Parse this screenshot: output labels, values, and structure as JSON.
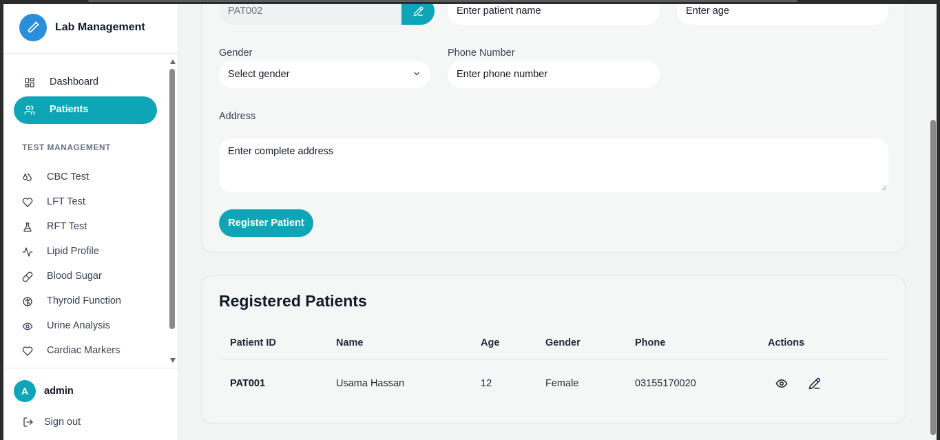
{
  "app": {
    "title": "Lab Management"
  },
  "colors": {
    "accent": "#0ea5b7",
    "logo": "#2a8fd8"
  },
  "sidebar": {
    "nav": [
      {
        "label": "Dashboard",
        "icon": "dashboard-icon"
      },
      {
        "label": "Patients",
        "icon": "users-icon",
        "active": true
      }
    ],
    "section_label": "TEST MANAGEMENT",
    "tests": [
      {
        "label": "CBC Test",
        "icon": "droplets-icon"
      },
      {
        "label": "LFT Test",
        "icon": "heart-icon"
      },
      {
        "label": "RFT Test",
        "icon": "flask-icon"
      },
      {
        "label": "Lipid Profile",
        "icon": "activity-icon"
      },
      {
        "label": "Blood Sugar",
        "icon": "pill-icon"
      },
      {
        "label": "Thyroid Function",
        "icon": "brain-icon"
      },
      {
        "label": "Urine Analysis",
        "icon": "eye-icon"
      },
      {
        "label": "Cardiac Markers",
        "icon": "heart-icon"
      }
    ],
    "user": {
      "initial": "A",
      "name": "admin"
    },
    "signout_label": "Sign out"
  },
  "form": {
    "patient_id_value": "PAT002",
    "patient_name_placeholder": "Enter patient name",
    "age_placeholder": "Enter age",
    "gender_label": "Gender",
    "gender_value": "Select gender",
    "phone_label": "Phone Number",
    "phone_placeholder": "Enter phone number",
    "address_label": "Address",
    "address_placeholder": "Enter complete address",
    "submit_label": "Register Patient"
  },
  "patients_table": {
    "title": "Registered Patients",
    "columns": [
      "Patient ID",
      "Name",
      "Age",
      "Gender",
      "Phone",
      "Actions"
    ],
    "rows": [
      {
        "id": "PAT001",
        "name": "Usama Hassan",
        "age": "12",
        "gender": "Female",
        "phone": "03155170020"
      }
    ]
  }
}
